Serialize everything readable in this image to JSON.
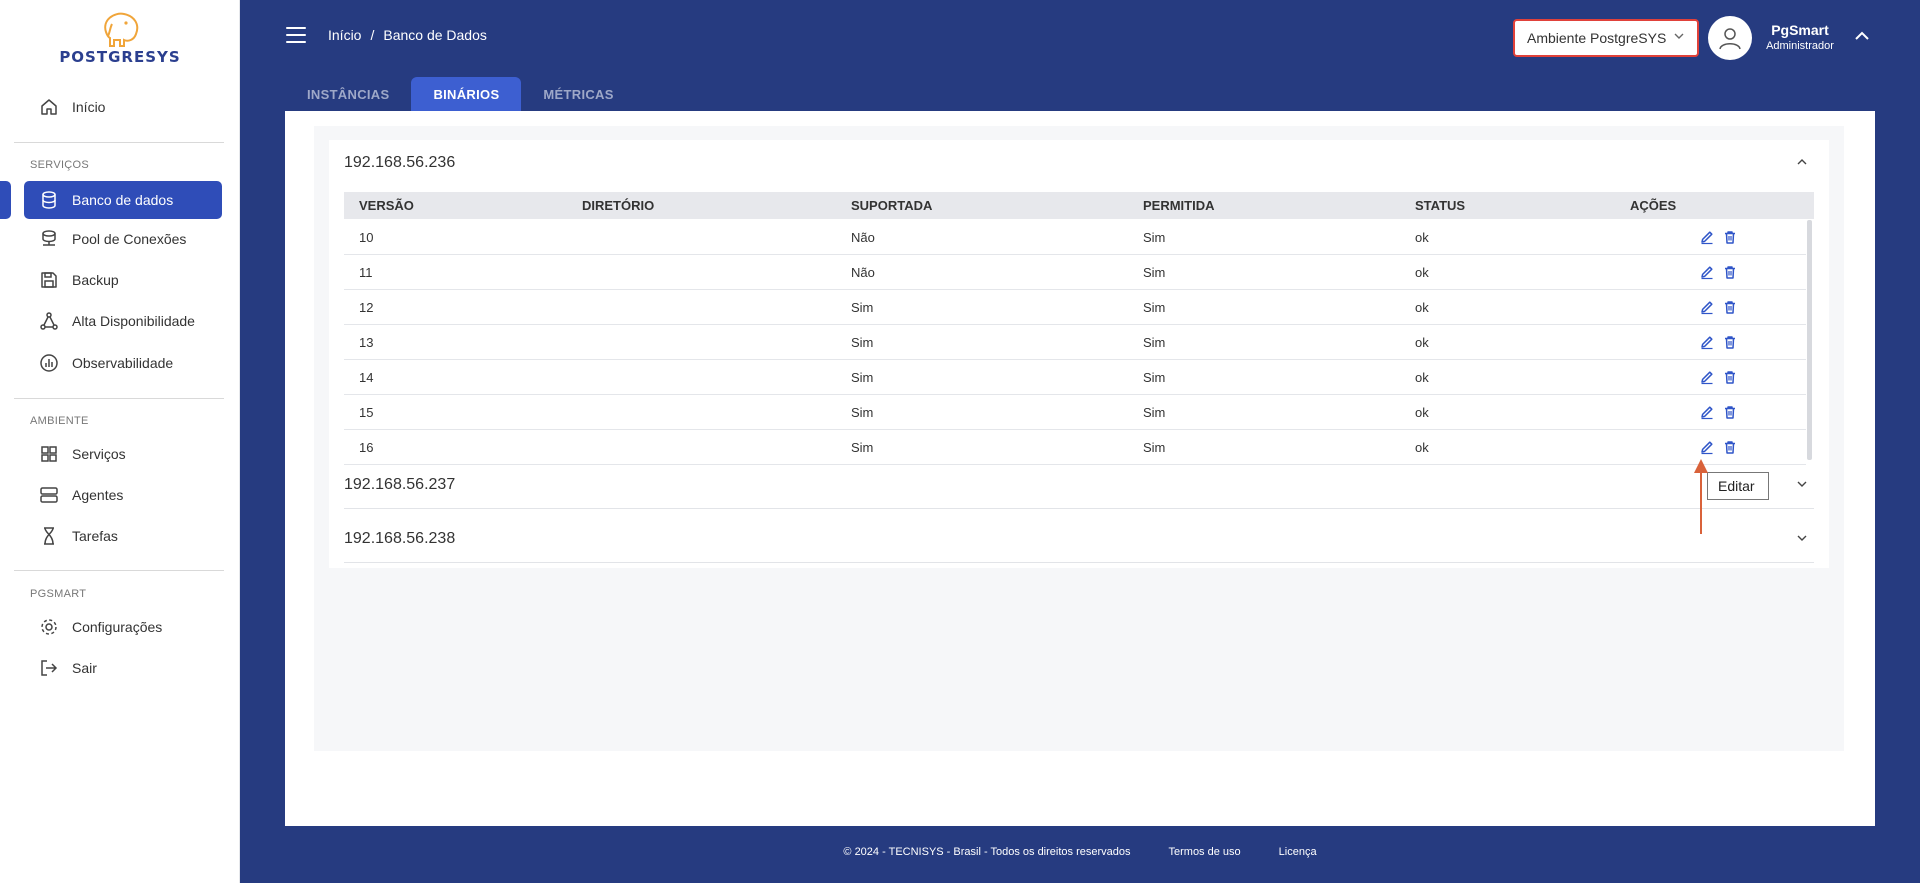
{
  "sidebar": {
    "logo": "POSTGRESYS",
    "home": "Início",
    "sections": {
      "servicos": "SERVIÇOS",
      "ambiente": "AMBIENTE",
      "pgsmart": "PGSMART"
    },
    "servicos_items": [
      "Banco de dados",
      "Pool de Conexões",
      "Backup",
      "Alta Disponibilidade",
      "Observabilidade"
    ],
    "ambiente_items": [
      "Serviços",
      "Agentes",
      "Tarefas"
    ],
    "pgsmart_items": [
      "Configurações",
      "Sair"
    ]
  },
  "topbar": {
    "breadcrumb": [
      "Início",
      "Banco de Dados"
    ],
    "breadcrumb_sep": "/",
    "environment": "Ambiente PostgreSYS",
    "user_name": "PgSmart",
    "user_role": "Administrador"
  },
  "tabs": [
    "INSTÂNCIAS",
    "BINÁRIOS",
    "MÉTRICAS"
  ],
  "active_tab": "BINÁRIOS",
  "hosts": [
    "192.168.56.236",
    "192.168.56.237",
    "192.168.56.238"
  ],
  "table": {
    "headers": [
      "VERSÃO",
      "DIRETÓRIO",
      "SUPORTADA",
      "PERMITIDA",
      "STATUS",
      "AÇÕES"
    ],
    "rows": [
      {
        "versao": "10",
        "diretorio": "",
        "suportada": "Não",
        "permitida": "Sim",
        "status": "ok"
      },
      {
        "versao": "11",
        "diretorio": "",
        "suportada": "Não",
        "permitida": "Sim",
        "status": "ok"
      },
      {
        "versao": "12",
        "diretorio": "",
        "suportada": "Sim",
        "permitida": "Sim",
        "status": "ok"
      },
      {
        "versao": "13",
        "diretorio": "",
        "suportada": "Sim",
        "permitida": "Sim",
        "status": "ok"
      },
      {
        "versao": "14",
        "diretorio": "",
        "suportada": "Sim",
        "permitida": "Sim",
        "status": "ok"
      },
      {
        "versao": "15",
        "diretorio": "",
        "suportada": "Sim",
        "permitida": "Sim",
        "status": "ok"
      },
      {
        "versao": "16",
        "diretorio": "",
        "suportada": "Sim",
        "permitida": "Sim",
        "status": "ok"
      }
    ]
  },
  "tooltip": "Editar",
  "footer": {
    "copyright": "© 2024 - TECNISYS - Brasil - Todos os direitos reservados",
    "terms": "Termos de uso",
    "license": "Licença"
  },
  "colors": {
    "brand_blue": "#263b80",
    "active_blue": "#2f4db8",
    "env_border": "#e0413a",
    "annotation_arrow": "#d9623a"
  },
  "icons": {
    "home": "home-icon",
    "database": "database-icon",
    "pool": "server-stack-icon",
    "backup": "save-icon",
    "ha": "triangle-nodes-icon",
    "obs": "chart-circle-icon",
    "services": "grid-icon",
    "agents": "server-icon",
    "tasks": "hourglass-icon",
    "config": "gear-icon",
    "logout": "logout-icon",
    "edit": "pencil-icon",
    "delete": "trash-icon"
  }
}
